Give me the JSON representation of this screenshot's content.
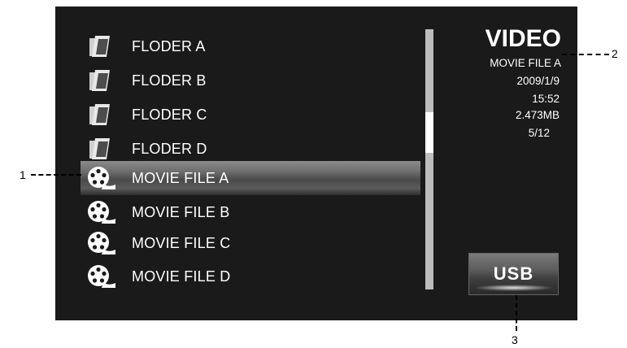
{
  "file_list": {
    "items": [
      {
        "label": "FLODER A",
        "type": "folder",
        "icon": "folder-icon",
        "selected": false
      },
      {
        "label": "FLODER B",
        "type": "folder",
        "icon": "folder-icon",
        "selected": false
      },
      {
        "label": "FLODER C",
        "type": "folder",
        "icon": "folder-icon",
        "selected": false
      },
      {
        "label": "FLODER D",
        "type": "folder",
        "icon": "folder-icon",
        "selected": false
      },
      {
        "label": "MOVIE FILE A",
        "type": "movie",
        "icon": "film-reel-icon",
        "selected": true
      },
      {
        "label": "MOVIE FILE B",
        "type": "movie",
        "icon": "film-reel-icon",
        "selected": false
      },
      {
        "label": "MOVIE FILE C",
        "type": "movie",
        "icon": "film-reel-icon",
        "selected": false
      },
      {
        "label": "MOVIE FILE D",
        "type": "movie",
        "icon": "film-reel-icon",
        "selected": false
      }
    ]
  },
  "info_panel": {
    "title": "VIDEO",
    "file_name": "MOVIE FILE A",
    "date": "2009/1/9",
    "time": "15:52",
    "size": "2.473MB",
    "position": "5/12"
  },
  "source_button": {
    "label": "USB"
  },
  "callouts": {
    "one": "1",
    "two": "2",
    "three": "3"
  },
  "colors": {
    "screen_bg": "#1a1a1a",
    "text": "#ffffff",
    "scrollbar_track": "#bdbdbd",
    "scrollbar_thumb": "#ffffff",
    "selection_highlight": "#6f6f6f"
  }
}
